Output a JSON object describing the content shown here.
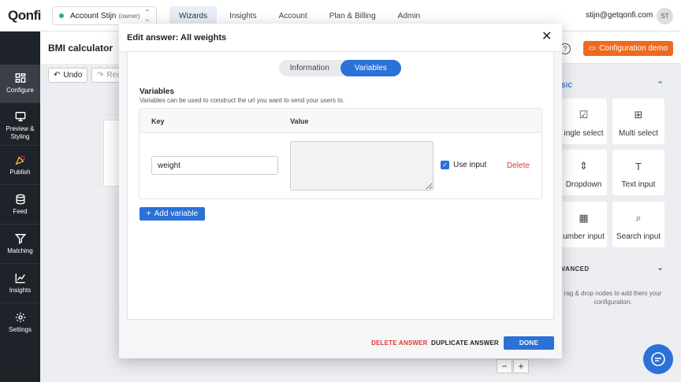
{
  "topbar": {
    "logo": "Qonfi",
    "account_name": "Account Stijn",
    "account_role": "(owner)",
    "nav": [
      "Wizards",
      "Insights",
      "Account",
      "Plan & Billing",
      "Admin"
    ],
    "user_email": "stijn@getqonfi.com",
    "avatar_initials": "ST"
  },
  "sidebar": {
    "items": [
      {
        "label": "Configure",
        "icon": "configure-icon"
      },
      {
        "label": "Preview & Styling",
        "icon": "monitor-icon"
      },
      {
        "label": "Publish",
        "icon": "party-icon"
      },
      {
        "label": "Feed",
        "icon": "database-icon"
      },
      {
        "label": "Matching",
        "icon": "filter-icon"
      },
      {
        "label": "Insights",
        "icon": "chart-icon"
      },
      {
        "label": "Settings",
        "icon": "gear-icon"
      }
    ]
  },
  "editor": {
    "title": "BMI calculator",
    "undo": "Undo",
    "redo": "Red",
    "zoom_out": "−",
    "zoom_in": "+"
  },
  "right_panel": {
    "help": "?",
    "config_demo": "Configuration demo",
    "basic_label": "SIC",
    "advanced_label": "VANCED",
    "tiles": [
      {
        "label": "ingle select",
        "icon": "checkbox-icon"
      },
      {
        "label": "Multi select",
        "icon": "grid-icon"
      },
      {
        "label": "Dropdown",
        "icon": "updown-icon"
      },
      {
        "label": "Text input",
        "icon": "text-icon"
      },
      {
        "label": "umber input",
        "icon": "calculator-icon"
      },
      {
        "label": "Search input",
        "icon": "search-icon"
      }
    ],
    "hint_line1": "rag & drop nodes to add them your",
    "hint_line2": "configuration."
  },
  "modal": {
    "title": "Edit answer: All weights",
    "close": "✕",
    "tabs": [
      "Information",
      "Variables"
    ],
    "active_tab": "Variables",
    "variables_title": "Variables",
    "variables_desc": "Variables can be used to construct the url you want to send your users to.",
    "columns": {
      "key": "Key",
      "value": "Value"
    },
    "row": {
      "key": "weight",
      "value": "",
      "use_input_label": "Use input",
      "use_input_checked": true,
      "delete": "Delete"
    },
    "add_variable": "Add variable",
    "footer": {
      "delete": "DELETE ANSWER",
      "duplicate": "DUPLICATE ANSWER",
      "done": "DONE"
    }
  },
  "colors": {
    "primary": "#2b71d8",
    "danger": "#e0392f",
    "accent": "#ee6a1f",
    "sidebar": "#1e2229"
  }
}
